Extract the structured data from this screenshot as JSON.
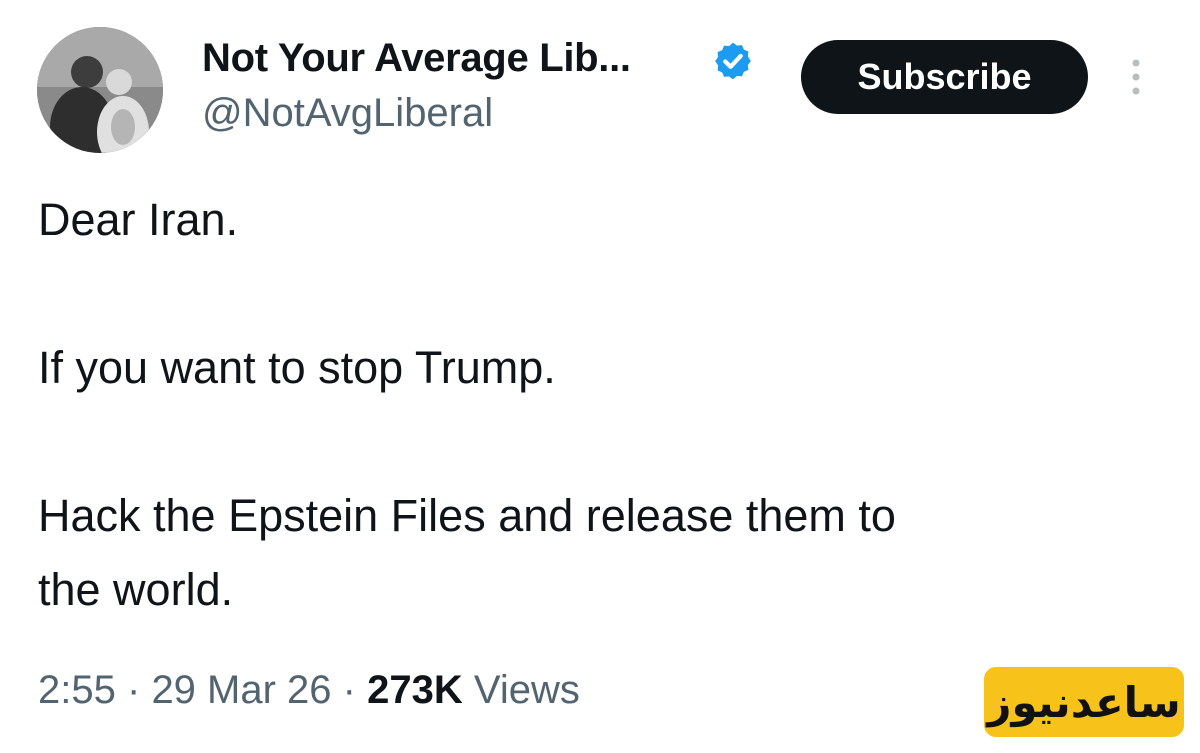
{
  "tweet": {
    "author": {
      "display_name": "Not Your Average Lib...",
      "handle": "@NotAvgLiberal",
      "verified": true,
      "avatar_icon": "profile-photo",
      "verified_icon": "verified-badge-icon"
    },
    "subscribe_label": "Subscribe",
    "more_icon": "vertical-ellipsis-icon",
    "text_lines": [
      "Dear Iran.",
      "If you want to stop Trump.",
      "Hack the Epstein Files and release them to",
      "the world."
    ],
    "meta": {
      "time": "2:55",
      "separator": "·",
      "date": "29 Mar 26",
      "views_count": "273K",
      "views_label": "Views"
    }
  },
  "watermark": {
    "text": "ساعدنیوز"
  },
  "colors": {
    "text": "#0f1419",
    "muted": "#536471",
    "verified_blue": "#1d9bf0",
    "button_bg": "#0f1419",
    "watermark_bg": "#f7c21a"
  }
}
